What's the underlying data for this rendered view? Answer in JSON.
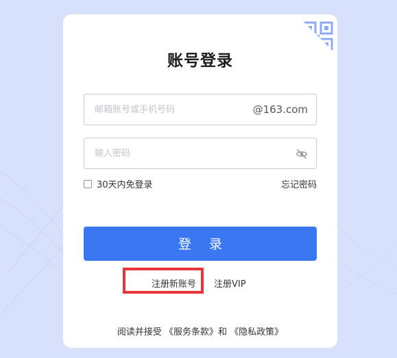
{
  "login": {
    "title": "账号登录",
    "email_placeholder": "邮箱账号或手机号码",
    "email_suffix": "@163.com",
    "password_placeholder": "输入密码",
    "remember_label": "30天内免登录",
    "remember_checked": false,
    "forgot_label": "忘记密码",
    "login_button": "登 录",
    "register_label": "注册新账号",
    "register_vip_label": "注册VIP",
    "terms_prefix": "阅读并接受",
    "terms_service": "《服务条款》",
    "terms_and": "和",
    "terms_privacy": "《隐私政策》"
  },
  "colors": {
    "background": "#d8e1fb",
    "card": "#ffffff",
    "primary_button": "#3a78f2",
    "highlight_box": "#e8353a",
    "qr_icon": "#8fa8ff"
  },
  "icons": {
    "corner": "qr-code-icon",
    "password_toggle": "eye-slash-icon"
  }
}
